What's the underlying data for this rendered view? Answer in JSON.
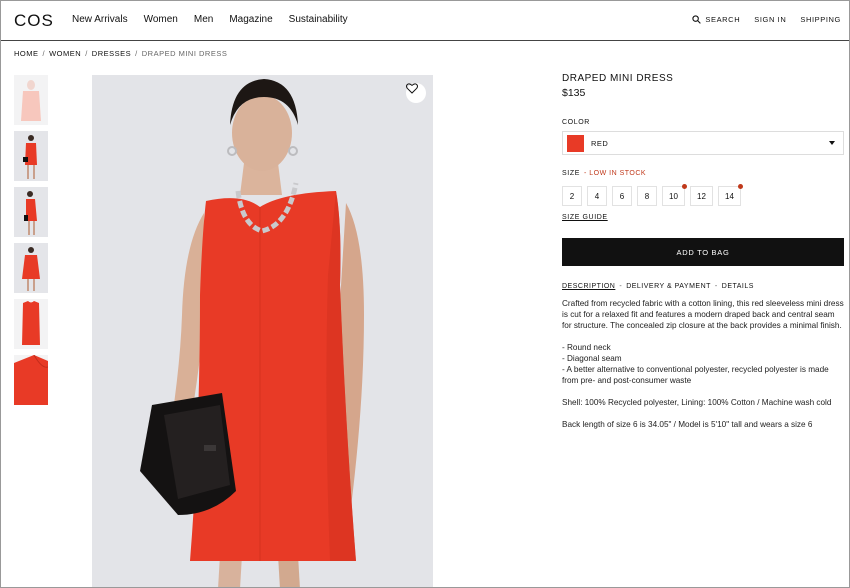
{
  "header": {
    "logo": "COS",
    "nav": [
      "New Arrivals",
      "Women",
      "Men",
      "Magazine",
      "Sustainability"
    ],
    "search_label": "SEARCH",
    "sign_in_label": "SIGN IN",
    "shipping_label": "SHIPPING"
  },
  "breadcrumb": [
    "HOME",
    "WOMEN",
    "DRESSES",
    "DRAPED MINI DRESS"
  ],
  "breadcrumb_sep": "/",
  "product": {
    "title": "DRAPED MINI DRESS",
    "price": "$135",
    "color_label": "COLOR",
    "color_name": "RED",
    "color_hex": "#e83a26",
    "size_label": "SIZE",
    "stock_note": "- LOW IN STOCK",
    "sizes": [
      "2",
      "4",
      "6",
      "8",
      "10",
      "12",
      "14"
    ],
    "low_stock_sizes": [
      "10",
      "14"
    ],
    "size_guide_label": "SIZE GUIDE",
    "add_to_bag_label": "ADD TO BAG"
  },
  "tabs": {
    "description": "DESCRIPTION",
    "delivery": "DELIVERY & PAYMENT",
    "details": "DETAILS",
    "separator": "-"
  },
  "description": {
    "intro": "Crafted from recycled fabric with a cotton lining, this red sleeveless mini dress is cut for a relaxed fit and features a modern draped back and central seam for structure. The concealed zip closure at the back provides a minimal finish.",
    "bullets": [
      "- Round neck",
      "- Diagonal seam",
      "- A better alternative to conventional polyester, recycled polyester is made from pre- and post-consumer waste"
    ],
    "composition": "Shell: 100% Recycled polyester, Lining: 100% Cotton / Machine wash cold",
    "fit": "Back length of size 6 is 34.05\" / Model is 5'10\" tall and wears a size 6"
  },
  "icons": {
    "search": "search-icon",
    "wishlist": "heart-icon",
    "dropdown": "chevron-down-icon"
  },
  "colors": {
    "accent_red": "#e83a26",
    "stock_red": "#c0391b",
    "button_black": "#111111",
    "image_bg": "#e3e4e8"
  }
}
